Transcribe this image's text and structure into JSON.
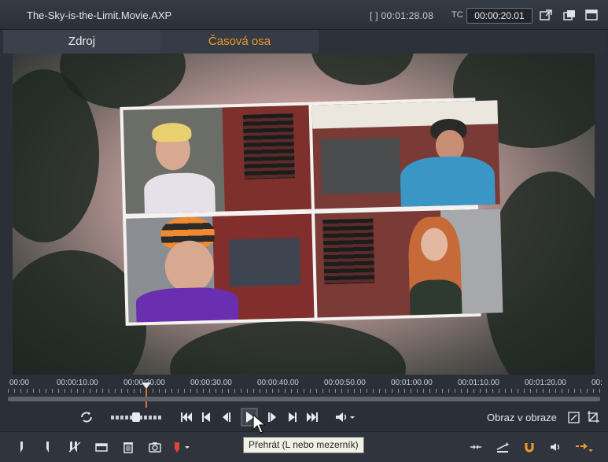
{
  "window": {
    "title": "The-Sky-is-the-Limit.Movie.AXP",
    "duration_label": "[ ] 00:01:28.08",
    "tc_label": "TC",
    "timecode": "00:00:20.01"
  },
  "tabs": [
    {
      "label": "Zdroj",
      "active": false
    },
    {
      "label": "Časová osa",
      "active": true
    }
  ],
  "ruler": {
    "ticks": [
      "00:00",
      "00:00:10.00",
      "00:00:20.00",
      "00:00:30.00",
      "00:00:40.00",
      "00:00:50.00",
      "00:01:00.00",
      "00:01:10.00",
      "00:01:20.00",
      "00:"
    ]
  },
  "transport": {
    "loop_icon": "loop-icon",
    "pip_label": "Obraz v obraze",
    "buttons": [
      "go-to-start-icon",
      "prev-frame-icon",
      "step-back-icon",
      "play-icon",
      "step-forward-icon",
      "next-frame-icon",
      "go-to-end-icon",
      "volume-icon"
    ]
  },
  "tooltip": {
    "text": "Přehrát (L nebo mezerník)"
  },
  "bottom_tools": [
    "marker-icon",
    "split-icon",
    "razor-icon",
    "storyboard-icon",
    "trash-icon",
    "snapshot-icon",
    "color-marker-icon",
    "audio-mixer-icon",
    "insert-icon",
    "magnet-icon",
    "speaker-icon",
    "move-mode-icon"
  ],
  "colors": {
    "accent": "#f09a2b",
    "playhead": "#e0692b",
    "background": "#2b3038"
  }
}
